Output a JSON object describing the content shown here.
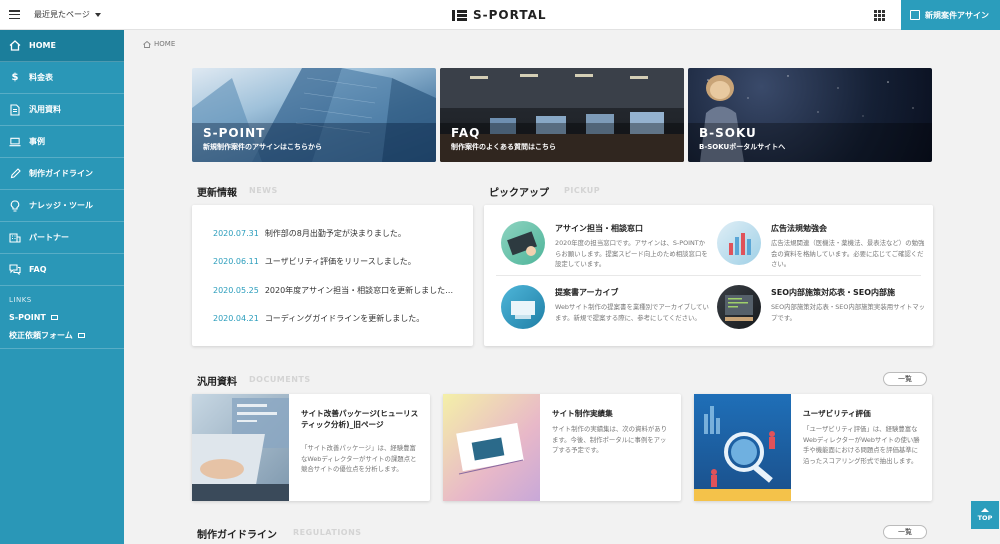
{
  "header": {
    "recent_label": "最近見たページ",
    "logo_text": "S-PORTAL",
    "assign_label": "新規案件アサイン"
  },
  "sidebar": {
    "items": [
      {
        "label": "HOME",
        "icon": "home-icon"
      },
      {
        "label": "料金表",
        "icon": "dollar-icon"
      },
      {
        "label": "汎用資料",
        "icon": "document-icon"
      },
      {
        "label": "事例",
        "icon": "laptop-icon"
      },
      {
        "label": "制作ガイドライン",
        "icon": "pencil-icon"
      },
      {
        "label": "ナレッジ・ツール",
        "icon": "lightbulb-icon"
      },
      {
        "label": "パートナー",
        "icon": "building-icon"
      },
      {
        "label": "FAQ",
        "icon": "chat-icon"
      }
    ],
    "links_heading": "LINKS",
    "links": [
      {
        "label": "S-POINT"
      },
      {
        "label": "校正依頼フォーム"
      }
    ]
  },
  "breadcrumb": {
    "label": "HOME"
  },
  "heroes": [
    {
      "title": "S-POINT",
      "subtitle": "新規制作案件のアサインはこちらから"
    },
    {
      "title": "FAQ",
      "subtitle": "制作案件のよくある質問はこちら"
    },
    {
      "title": "B-SOKU",
      "subtitle": "B-SOKUポータルサイトへ"
    }
  ],
  "news": {
    "title": "更新情報",
    "title_en": "NEWS",
    "items": [
      {
        "date": "2020.07.31",
        "text": "制作部の8月出勤予定が決まりました。"
      },
      {
        "date": "2020.06.11",
        "text": "ユーザビリティ評価をリリースしました。"
      },
      {
        "date": "2020.05.25",
        "text": "2020年度アサイン担当・相談窓口を更新しました…"
      },
      {
        "date": "2020.04.21",
        "text": "コーディングガイドラインを更新しました。"
      }
    ]
  },
  "pickup": {
    "title": "ピックアップ",
    "title_en": "PICKUP",
    "items": [
      {
        "title": "アサイン担当・相談窓口",
        "desc": "2020年度の担当窓口です。アサインは、S-POINTからお願いします。提案スピード向上のため相談窓口を設定しています。"
      },
      {
        "title": "広告法規勉強会",
        "desc": "広告法規関連（医機法・薬機法、景表法など）の勉強会の資料を格納しています。必要に応じてご確認ください。"
      },
      {
        "title": "提案書アーカイブ",
        "desc": "Webサイト制作の提案書を業種別でアーカイブしています。新規で提案する際に、参考にしてください。"
      },
      {
        "title": "SEO内部施策対応表・SEO内部施",
        "desc": "SEO内部施策対応表・SEO内部施策実装用サイトマップです。"
      }
    ]
  },
  "documents": {
    "title": "汎用資料",
    "title_en": "DOCUMENTS",
    "more_label": "一覧",
    "items": [
      {
        "title": "サイト改善パッケージ(ヒューリスティック分析)_旧ページ",
        "desc": "「サイト改善パッケージ」は、経験豊富なWebディレクターがサイトの課題点と競合サイトの優位点を分析します。"
      },
      {
        "title": "サイト制作実績集",
        "desc": "サイト制作の実績集は、次の資料があります。今後、制作ポータルに事例をアップする予定です。"
      },
      {
        "title": "ユーザビリティ評価",
        "desc": "「ユーザビリティ評価」は、経験豊富なWebディレクターがWebサイトの使い勝手や機能面における問題点を評価基準に沿ったスコアリング形式で抽出します。"
      }
    ]
  },
  "regulations": {
    "title": "制作ガイドライン",
    "title_en": "REGULATIONS",
    "more_label": "一覧"
  },
  "top_button": {
    "label": "TOP"
  }
}
